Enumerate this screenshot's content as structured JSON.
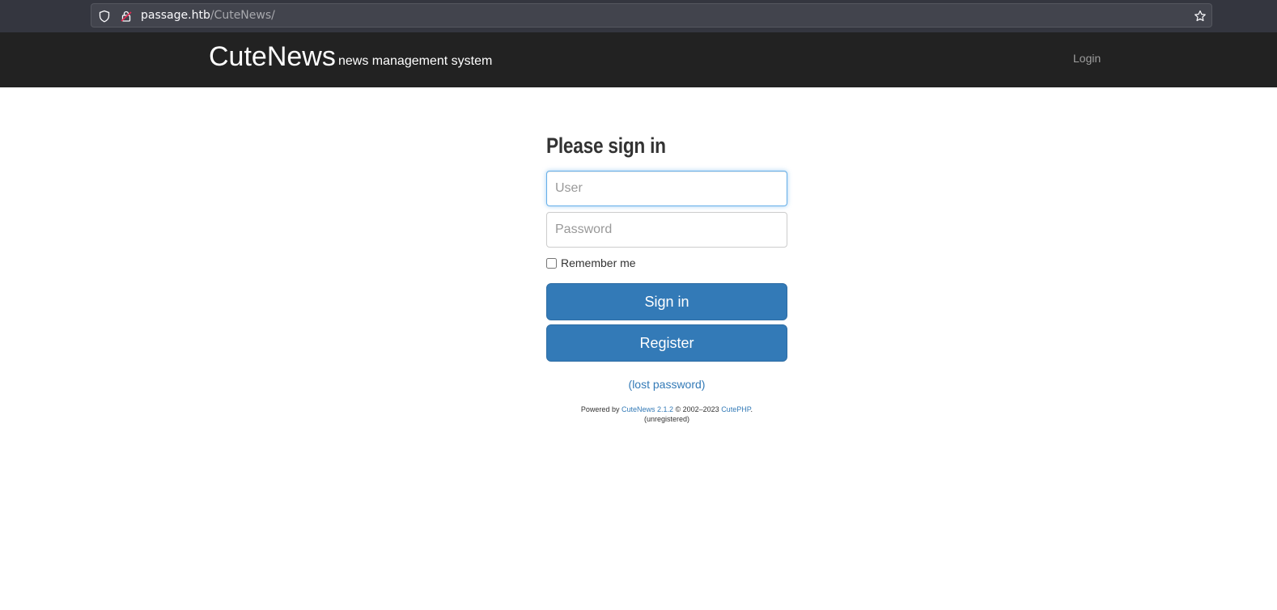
{
  "browser": {
    "url_host": "passage.htb",
    "url_path": "/CuteNews/",
    "icons": [
      "shield-icon",
      "lock-icon",
      "star-icon"
    ]
  },
  "navbar": {
    "brand": "CuteNews",
    "tagline": "news management system",
    "login_link": "Login",
    "background": "#222222"
  },
  "login_form": {
    "heading": "Please sign in",
    "user_placeholder": "User",
    "user_value": "",
    "password_placeholder": "Password",
    "password_value": "",
    "remember_label": "Remember me",
    "remember_checked": false,
    "signin_label": "Sign in",
    "register_label": "Register",
    "lost_password_label": "(lost password)",
    "button_color": "#337ab7"
  },
  "footer": {
    "powered_prefix": "Powered by ",
    "product_link": "CuteNews 2.1.2",
    "copyright": " © 2002–2023 ",
    "vendor_link": "CutePHP",
    "period": ".",
    "status": "(unregistered)"
  }
}
